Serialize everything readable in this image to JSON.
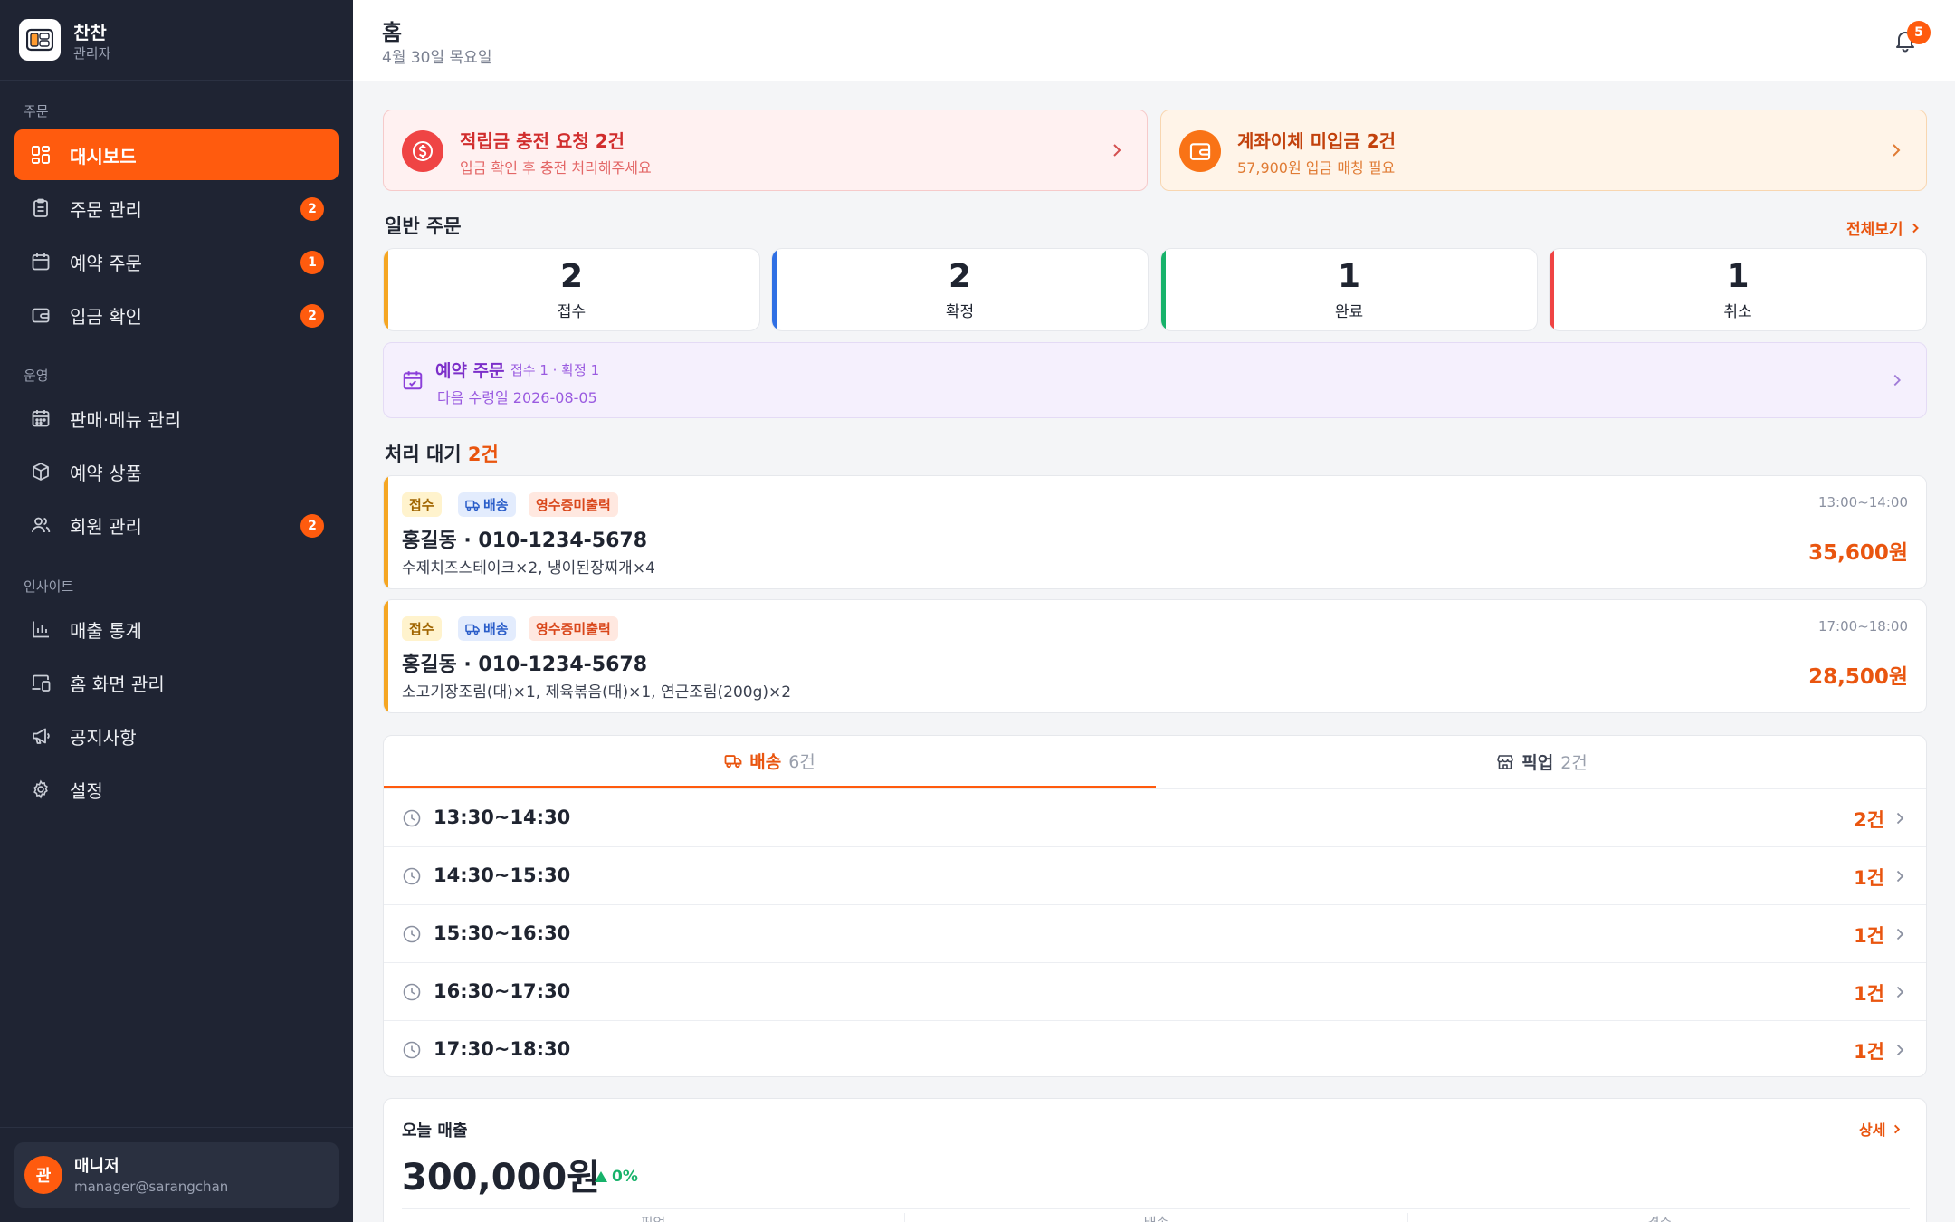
{
  "brand": {
    "name": "찬찬",
    "role": "관리자",
    "logo": "food-tray-icon"
  },
  "sidebar": {
    "sections": [
      {
        "title": "주문"
      },
      {
        "title": "운영"
      },
      {
        "title": "인사이트"
      }
    ],
    "items": [
      {
        "label": "대시보드",
        "icon": "dashboard-icon",
        "badge": null,
        "active": true
      },
      {
        "label": "주문 관리",
        "icon": "clipboard-icon",
        "badge": "2"
      },
      {
        "label": "예약 주문",
        "icon": "calendar-icon",
        "badge": "1"
      },
      {
        "label": "입금 확인",
        "icon": "wallet-icon",
        "badge": "2"
      },
      {
        "label": "판매·메뉴 관리",
        "icon": "calendar-grid-icon",
        "badge": null
      },
      {
        "label": "예약 상품",
        "icon": "box-icon",
        "badge": null
      },
      {
        "label": "회원 관리",
        "icon": "users-icon",
        "badge": "2"
      },
      {
        "label": "매출 통계",
        "icon": "bar-chart-icon",
        "badge": null
      },
      {
        "label": "홈 화면 관리",
        "icon": "devices-icon",
        "badge": null
      },
      {
        "label": "공지사항",
        "icon": "megaphone-icon",
        "badge": null
      },
      {
        "label": "설정",
        "icon": "gear-icon",
        "badge": null
      }
    ],
    "user": {
      "avatar": "관",
      "name": "매니저",
      "email": "manager@sarangchan"
    }
  },
  "header": {
    "title": "홈",
    "date": "4월 30일 목요일",
    "notifications": "5"
  },
  "alerts": [
    {
      "title": "적립금 충전 요청 2건",
      "sub": "입금 확인 후 충전 처리해주세요",
      "icon": "coin-icon"
    },
    {
      "title": "계좌이체 미입금 2건",
      "sub": "57,900원 입금 매칭 필요",
      "icon": "wallet-icon"
    }
  ],
  "orders_section": {
    "title": "일반 주문",
    "view_all": "전체보기",
    "stats": [
      {
        "value": "2",
        "label": "접수",
        "color": "#f5a623"
      },
      {
        "value": "2",
        "label": "확정",
        "color": "#2f6fe4"
      },
      {
        "value": "1",
        "label": "완료",
        "color": "#17b26a"
      },
      {
        "value": "1",
        "label": "취소",
        "color": "#ef4444"
      }
    ]
  },
  "reservation": {
    "title": "예약 주문",
    "meta": "접수 1 · 확정 1",
    "next": "다음 수령일 2026-08-05"
  },
  "pending": {
    "title": "처리 대기",
    "count": "2건",
    "orders": [
      {
        "tags": [
          "접수",
          "배송",
          "영수증미출력"
        ],
        "customer": "홍길동 · 010-1234-5678",
        "items": "수제치즈스테이크×2, 냉이된장찌개×4",
        "time": "13:00~14:00",
        "price": "35,600원"
      },
      {
        "tags": [
          "접수",
          "배송",
          "영수증미출력"
        ],
        "customer": "홍길동 · 010-1234-5678",
        "items": "소고기장조림(대)×1, 제육볶음(대)×1, 연근조림(200g)×2",
        "time": "17:00~18:00",
        "price": "28,500원"
      }
    ]
  },
  "delivery_tabs": {
    "tabs": [
      {
        "label": "배송",
        "count": "6건",
        "icon": "truck-icon",
        "active": true
      },
      {
        "label": "픽업",
        "count": "2건",
        "icon": "store-icon",
        "active": false
      }
    ],
    "slots": [
      {
        "time": "13:30~14:30",
        "count": "2건"
      },
      {
        "time": "14:30~15:30",
        "count": "1건"
      },
      {
        "time": "15:30~16:30",
        "count": "1건"
      },
      {
        "time": "16:30~17:30",
        "count": "1건"
      },
      {
        "time": "17:30~18:30",
        "count": "1건"
      }
    ]
  },
  "sales": {
    "title": "오늘 매출",
    "detail": "상세",
    "amount": "300,000원",
    "change": "0%",
    "columns": [
      "픽업",
      "배송",
      "결수"
    ]
  },
  "colors": {
    "accent": "#ff5b0e",
    "sidebar": "#1f2433"
  }
}
